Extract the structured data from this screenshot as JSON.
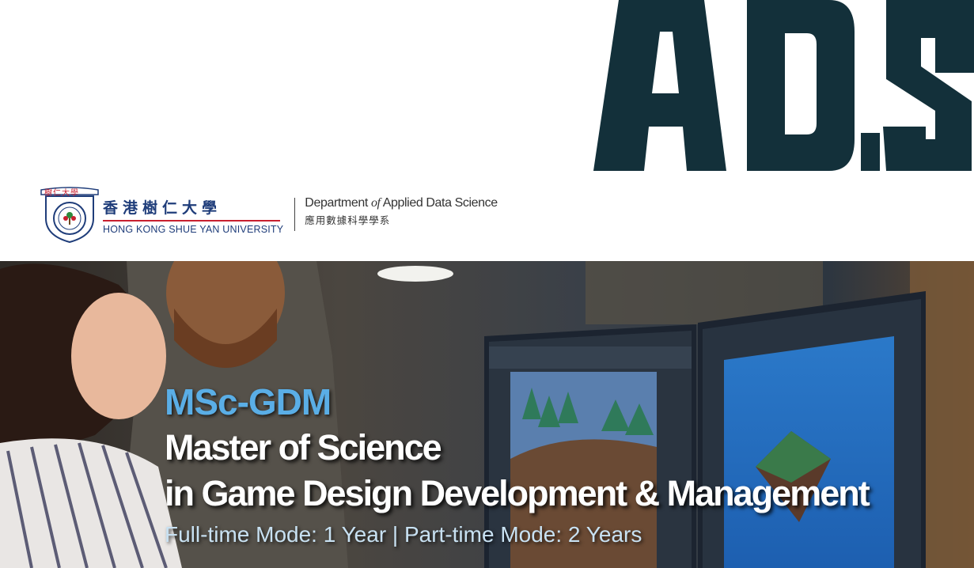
{
  "header": {
    "ads_logo_text": "ADS",
    "university": {
      "crest_label": "樹仁大學",
      "name_cn": "香港樹仁大學",
      "name_en": "HONG KONG SHUE YAN UNIVERSITY"
    },
    "department": {
      "en_before": "Department ",
      "en_of": "of",
      "en_after": " Applied Data Science",
      "cn": "應用數據科學學系"
    }
  },
  "hero": {
    "program_code": "MSc-GDM",
    "title_line1": "Master of Science",
    "title_line2": "in Game Design Development & Management",
    "mode": "Full-time Mode: 1 Year | Part-time Mode: 2 Years"
  },
  "colors": {
    "ads_logo": "#13303a",
    "program_code": "#5aaee6",
    "mode_text": "#c8e1f2",
    "university_blue": "#1f3d7a",
    "university_red": "#c8202f"
  }
}
